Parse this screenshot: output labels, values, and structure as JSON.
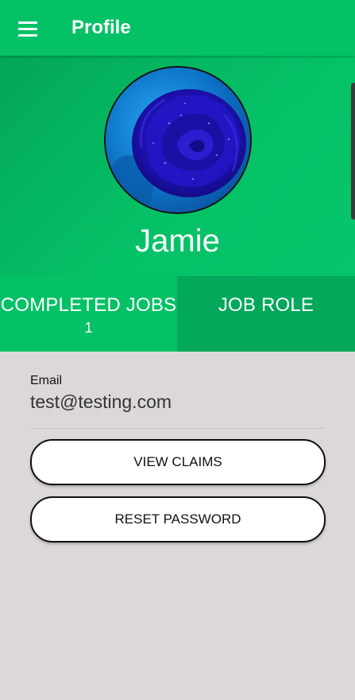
{
  "app_bar": {
    "title": "Profile",
    "menu_icon": "hamburger-menu-icon",
    "color": "#05c166"
  },
  "profile": {
    "name": "Jamie",
    "avatar_description": "blue-rose-avatar"
  },
  "stats": {
    "completed_jobs_label": "COMPLETED JOBS",
    "completed_jobs_value": "1",
    "job_role_label": "JOB ROLE",
    "job_role_value": ""
  },
  "details": {
    "email_label": "Email",
    "email_value": "test@testing.com"
  },
  "actions": {
    "view_claims_label": "VIEW CLAIMS",
    "reset_password_label": "RESET PASSWORD"
  },
  "colors": {
    "primary": "#05c166",
    "primary_dark": "#03a85a",
    "background": "#ddd8d8"
  }
}
